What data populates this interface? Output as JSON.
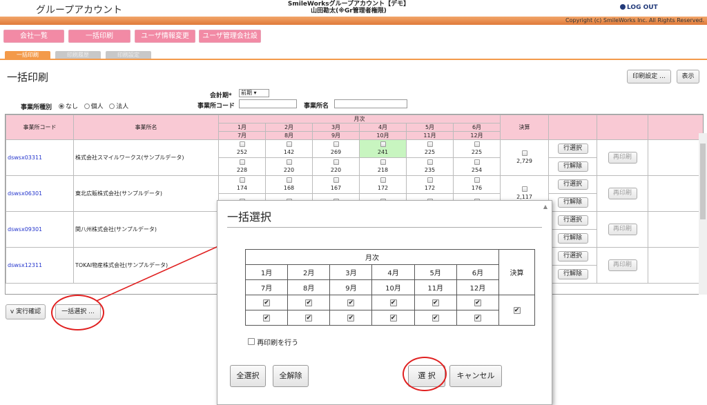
{
  "header": {
    "app_title": "グループアカウント",
    "center_line1": "SmileWorksグループアカウント【デモ】",
    "center_line2": "山田勘太(※Gr管理者権限)",
    "logout": "LOG OUT",
    "copyright": "Copyright (c) SmileWorks Inc. All Rights Reserved."
  },
  "nav": [
    "会社一覧",
    "一括印刷",
    "ユーザ情報変更",
    "ユーザ管理会社設定"
  ],
  "subtabs": [
    "一括印刷",
    "印刷履歴",
    "印刷設定"
  ],
  "page": {
    "title": "一括印刷",
    "print_settings": "印刷設定 ...",
    "display": "表示"
  },
  "filters": {
    "period_label": "会計期*",
    "period_value": "前期 ▾",
    "type_label": "事業所種別",
    "type_options": [
      "なし",
      "個人",
      "法人"
    ],
    "code_label": "事業所コード",
    "name_label": "事業所名"
  },
  "table": {
    "headers": {
      "code": "事業所コード",
      "name": "事業所名",
      "monthly": "月次",
      "settle": "決算"
    },
    "months_top": [
      "1月",
      "2月",
      "3月",
      "4月",
      "5月",
      "6月"
    ],
    "months_bottom": [
      "7月",
      "8月",
      "9月",
      "10月",
      "11月",
      "12月"
    ],
    "rows": [
      {
        "code": "dswsx03311",
        "name": "株式会社スマイルワークス(サンプルデータ)",
        "top": [
          "252",
          "142",
          "269",
          "241",
          "225",
          "225"
        ],
        "bottom": [
          "228",
          "220",
          "220",
          "218",
          "235",
          "254"
        ],
        "settle": "2,729"
      },
      {
        "code": "dswsx06301",
        "name": "東北広販株式会社(サンプルデータ)",
        "top": [
          "174",
          "168",
          "167",
          "172",
          "172",
          "176"
        ],
        "bottom": [
          "",
          "",
          "",
          "",
          "",
          ""
        ],
        "settle": "2,117"
      },
      {
        "code": "dswsx09301",
        "name": "関八州株式会社(サンプルデータ)",
        "top": [
          "",
          "",
          "",
          "",
          "",
          ""
        ],
        "bottom": [
          "",
          "",
          "",
          "",
          "",
          ""
        ],
        "settle": ""
      },
      {
        "code": "dswsx12311",
        "name": "TOKAI物産株式会社(サンプルデータ)",
        "top": [
          "",
          "",
          "",
          "",
          "",
          ""
        ],
        "bottom": [
          "",
          "",
          "",
          "",
          "",
          ""
        ],
        "settle": ""
      }
    ],
    "row_select": "行選択",
    "row_clear": "行解除",
    "reprint": "再印刷"
  },
  "bottom": {
    "exec_confirm": "v 実行確認",
    "bulk_select": "一括選択 ..."
  },
  "modal": {
    "title": "一括選択",
    "monthly": "月次",
    "settle": "決算",
    "months_top": [
      "1月",
      "2月",
      "3月",
      "4月",
      "5月",
      "6月"
    ],
    "months_bottom": [
      "7月",
      "8月",
      "9月",
      "10月",
      "11月",
      "12月"
    ],
    "check": "✔",
    "reprint_label": "再印刷を行う",
    "select_all": "全選択",
    "clear_all": "全解除",
    "select": "選 択",
    "cancel": "キャンセル"
  },
  "colors": {
    "nav_pink": "#f28aa5",
    "header_pink": "#f9c9d4",
    "orange": "#f39a4a",
    "highlight_green": "#c8f5c0",
    "annotation_red": "#e02020"
  }
}
